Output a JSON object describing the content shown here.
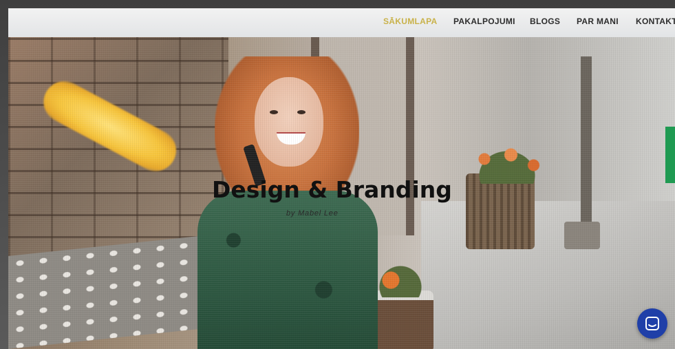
{
  "nav": {
    "items": [
      {
        "label": "SĀKUMLAPA",
        "active": true
      },
      {
        "label": "PAKALPOJUMI",
        "active": false
      },
      {
        "label": "BLOGS",
        "active": false
      },
      {
        "label": "PAR MANI",
        "active": false
      },
      {
        "label": "KONTAKTI",
        "active": false
      }
    ],
    "active_color": "#c9b24a"
  },
  "hero": {
    "title": "Design & Branding",
    "byline": "by Mabel Lee"
  },
  "chat_widget": {
    "icon": "chat-icon",
    "color": "#1f3fa8"
  },
  "side_tab": {
    "color": "#1f9a52"
  }
}
